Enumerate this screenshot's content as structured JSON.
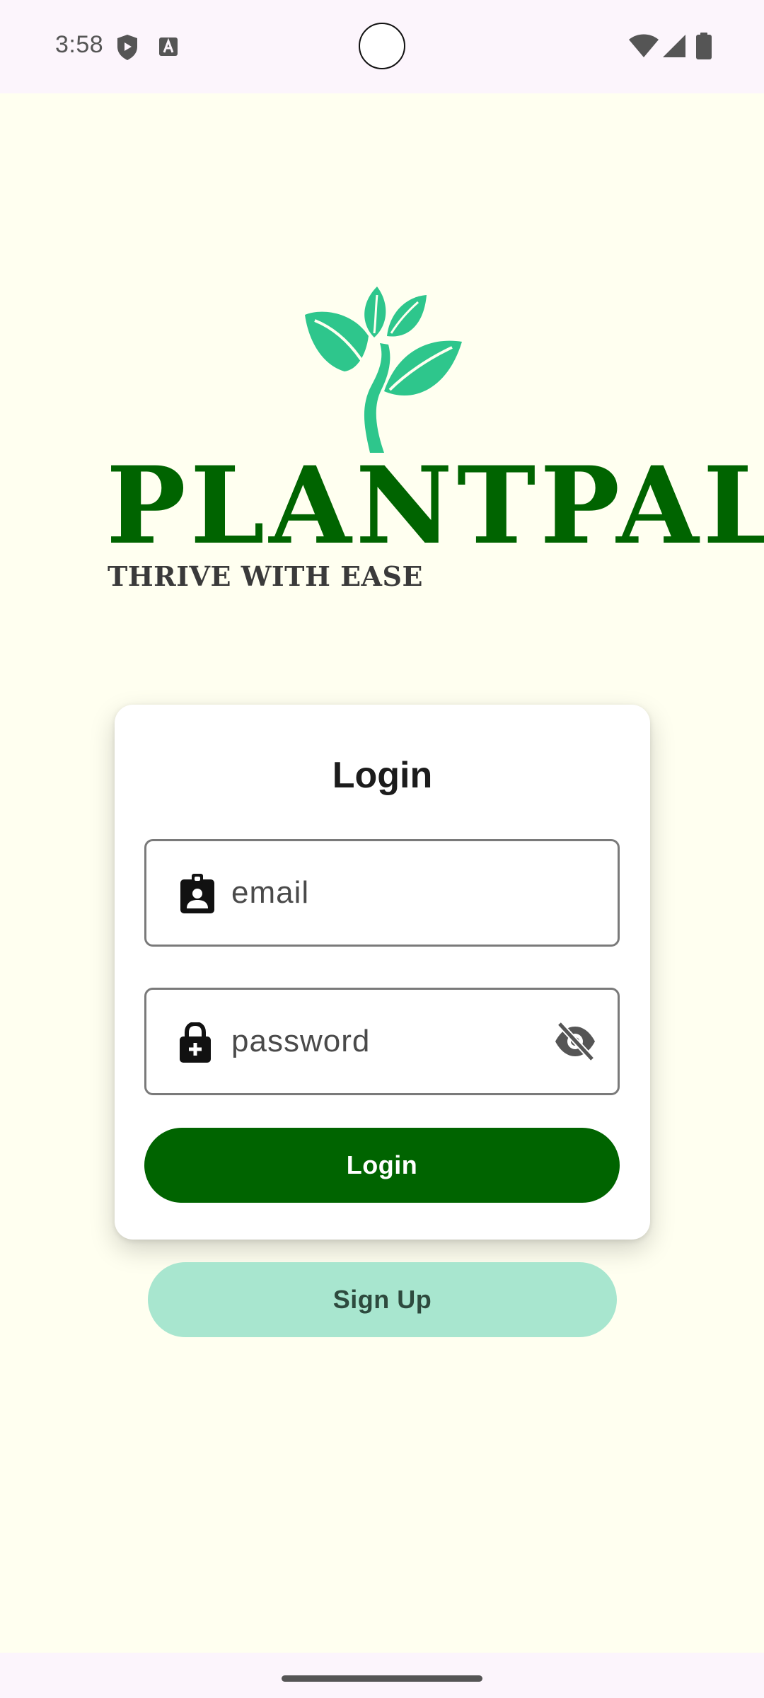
{
  "status_bar": {
    "time": "3:58",
    "icons": [
      "shield-play-icon",
      "text-a-icon",
      "wifi-icon",
      "signal-icon",
      "battery-icon"
    ]
  },
  "brand": {
    "name": "PLANTPAL",
    "tagline": "THRIVE WITH EASE",
    "logo_icon": "plant-sprout-icon",
    "colors": {
      "primary": "#006400",
      "leaf": "#2ec68c",
      "secondary": "#a8e6cf",
      "background": "#fffff0"
    }
  },
  "login_card": {
    "title": "Login",
    "email": {
      "placeholder": "email",
      "value": "",
      "icon": "badge-person-icon"
    },
    "password": {
      "placeholder": "password",
      "value": "",
      "icon": "lock-plus-icon",
      "toggle_icon": "eye-off-icon"
    },
    "login_label": "Login"
  },
  "signup_label": "Sign Up"
}
